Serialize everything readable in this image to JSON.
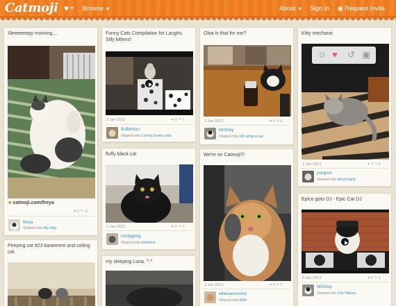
{
  "header": {
    "logo": "Catmoji",
    "browse": "Browse",
    "about": "About",
    "sign_in": "Sign In",
    "request_invite": "Request Invite",
    "accent": "#f1852a"
  },
  "cards": [
    {
      "title": "Sleeeeeepy morning....",
      "source": "catmoji.com/freya",
      "stats": {
        "likes": "0",
        "reposts": "11"
      },
      "user": "freya",
      "shared_prefix": "Shared into",
      "collection": "My kitty"
    },
    {
      "title": "Funny Cats Compilation for Laughs. Silly kittens!",
      "date": "3 Jan 2013",
      "stats": {
        "likes": "0",
        "reposts": "5"
      },
      "user": "fluffertton",
      "shared_prefix": "Shared into",
      "collection": "Lovely lovely cats"
    },
    {
      "title": "Ohai is that for me?",
      "date": "3 Jan 2013",
      "stats": {
        "likes": "0",
        "reposts": "6"
      },
      "user": "MrGrey",
      "shared_prefix": "Shared into",
      "collection": "Oh what a cat"
    },
    {
      "title": "Kitty mechanic",
      "date": "3 Jan 2013",
      "stats": {
        "likes": "0",
        "reposts": "8"
      },
      "user": "ponpon",
      "shared_prefix": "Shared into",
      "collection": "lol'ed hard"
    },
    {
      "title": "fluffy black cat",
      "date": "3 Jan 2013",
      "stats": {
        "likes": "0",
        "reposts": "3"
      },
      "user": "cindygreg",
      "shared_prefix": "Shared into",
      "collection": "lovelove"
    },
    {
      "title": "We're on Catmoji?!",
      "date": "3 Jan 2013",
      "stats": {
        "likes": "0",
        "reposts": "3"
      },
      "user": "elliesaurusrex",
      "shared_prefix": "Shared into",
      "collection": "Ellie"
    },
    {
      "title": "Epico goto DJ - Epic Cat DJ",
      "date": "3 Jan 2013",
      "stats": {
        "likes": "0",
        "reposts": "5"
      },
      "user": "MrGrey",
      "shared_prefix": "Shared into",
      "collection": "Cat Videos"
    },
    {
      "title": "Peeping cat #23 basement and ceiling cat."
    },
    {
      "title": "my sleeping Luna. ^.^"
    }
  ],
  "icons": {
    "reaction_icons": [
      "smiley-icon",
      "heart-icon",
      "repost-icon",
      "comment-icon"
    ],
    "heart_color": "#e8508a"
  }
}
